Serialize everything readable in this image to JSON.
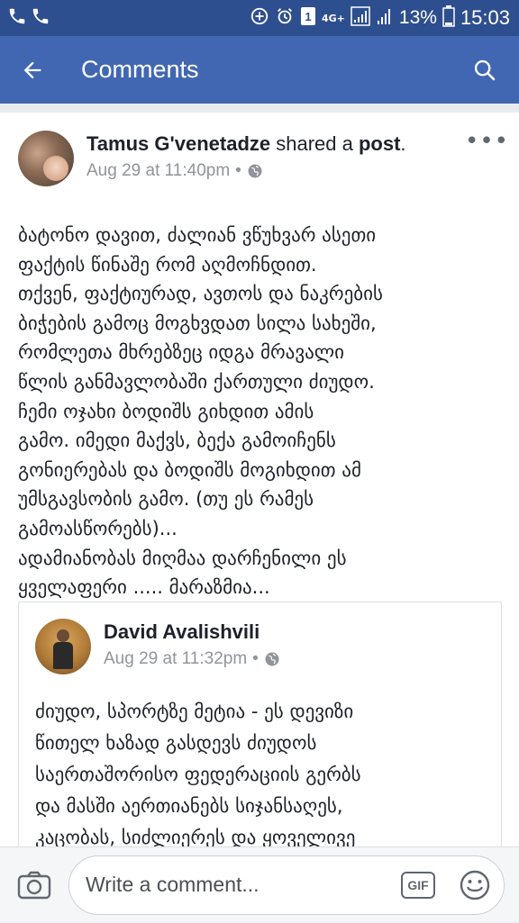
{
  "status_bar": {
    "network": "4G+",
    "battery": "13%",
    "time": "15:03"
  },
  "app_bar": {
    "title": "Comments"
  },
  "post": {
    "author": "Tamus G'venetadze",
    "action_text": " shared a ",
    "object_text": "post",
    "period": ".",
    "timestamp": "Aug 29 at 11:40pm",
    "separator": "•",
    "privacy_icon": "globe-icon",
    "text": "ბატონო დავით, ძალიან ვწუხვარ ასეთი\nფაქტის წინაშე რომ აღმოჩნდით.\nთქვენ, ფაქტიურად, ავთოს და ნაკრების\nბიჭების გამოც მოგხვდათ სილა სახეში,\nრომლეთა მხრებზეც იდგა მრავალი\nწლის განმავლობაში ქართული ძიუდო.\nჩემი ოჯახი ბოდიშს გიხდით ამის\nგამო. იმედი მაქვს, ბექა გამოიჩენს\nგონიერებას და ბოდიშს მოგიხდით ამ\nუმსგავსობის გამო. (თუ ეს რამეს\nგამოასწორებს)...\nადამიანობას მიღმაა დარჩენილი ეს\nყველაფერი ..... მარაზმია..."
  },
  "shared": {
    "author": "David Avalishvili",
    "timestamp": "Aug 29 at 11:32pm",
    "separator": "•",
    "text": "ძიუდო, სპორტზე მეტია - ეს დევიზი\nწითელ ხაზად გასდევს ძიუდოს\nსაერთაშორისო ფედერაციის გერბს\nდა მასში აერთიანებს სიჯანსაღეს,\nკაცობას, სიძლიერეს და ყოველივე"
  },
  "composer": {
    "placeholder": "Write a comment...",
    "gif_label": "GIF"
  },
  "colors": {
    "status_bar": "#2e4f8f",
    "app_bar": "#4267b2",
    "text": "#1d2129",
    "meta": "#90949c"
  }
}
